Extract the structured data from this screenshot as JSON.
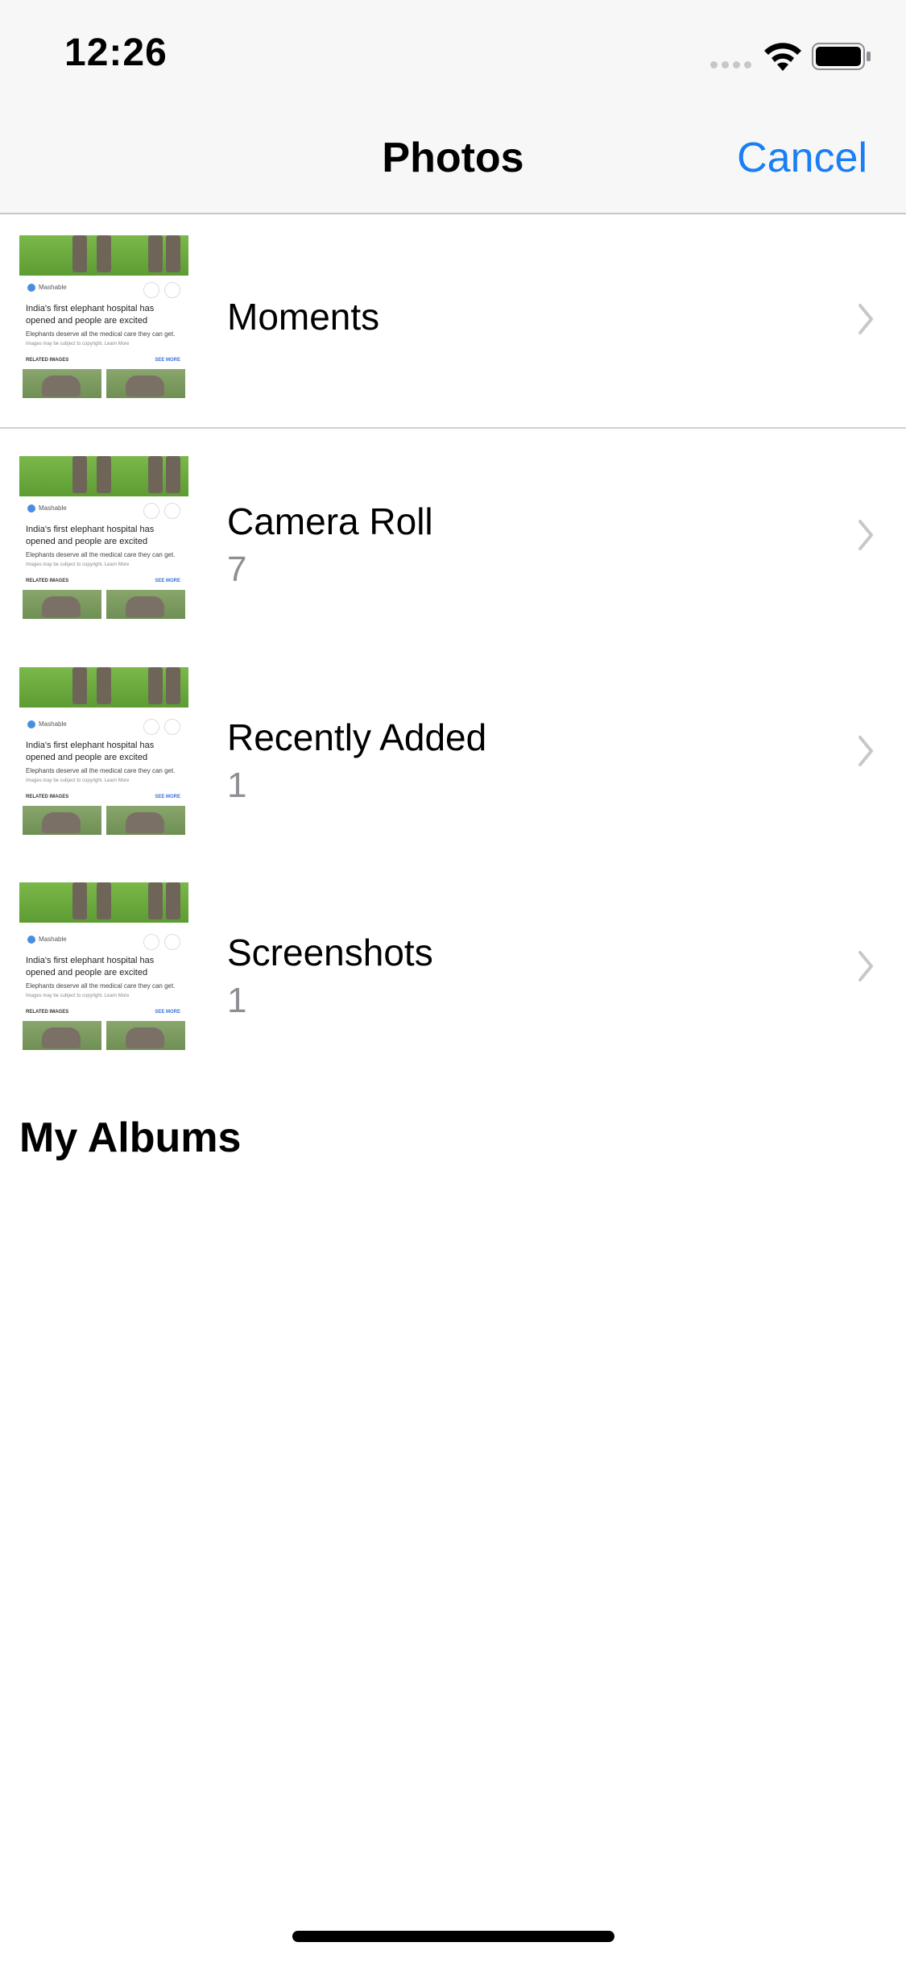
{
  "status_bar": {
    "time": "12:26"
  },
  "nav": {
    "title": "Photos",
    "cancel_label": "Cancel"
  },
  "thumbnail": {
    "source": "Mashable",
    "headline": "India's first elephant hospital has opened and people are excited",
    "subline": "Elephants deserve all the medical care they can get.",
    "copyright": "Images may be subject to copyright. Learn More",
    "related": "RELATED IMAGES",
    "see_more": "SEE MORE"
  },
  "albums": [
    {
      "name": "Moments",
      "count": ""
    },
    {
      "name": "Camera Roll",
      "count": "7"
    },
    {
      "name": "Recently Added",
      "count": "1"
    },
    {
      "name": "Screenshots",
      "count": "1"
    }
  ],
  "sections": {
    "my_albums": "My Albums"
  },
  "colors": {
    "accent": "#1a7ef5",
    "secondary_text": "#8e8e93",
    "chevron": "#c7c7cc"
  },
  "icons": [
    "cellular-signal-icon",
    "wifi-icon",
    "battery-icon",
    "chevron-right-icon"
  ]
}
